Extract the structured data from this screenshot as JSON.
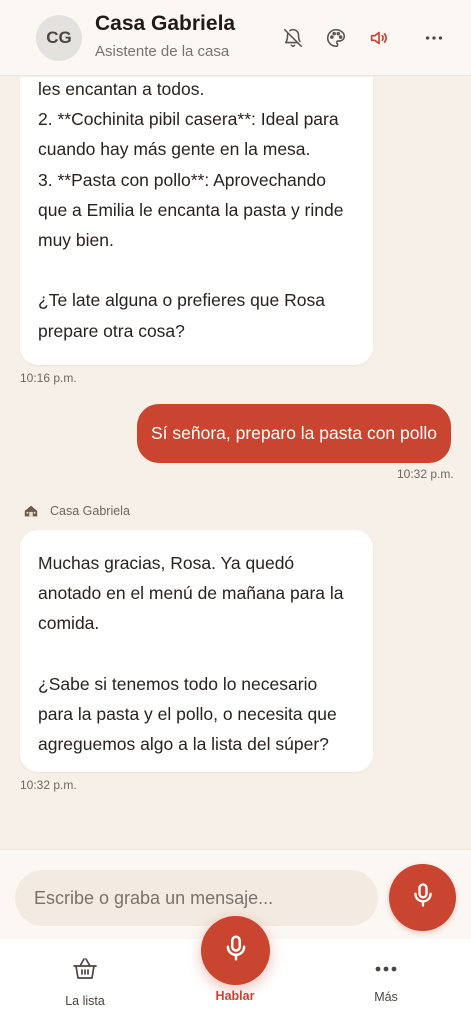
{
  "header": {
    "avatar_initials": "CG",
    "title": "Casa Gabriela",
    "subtitle": "Asistente de la casa",
    "icons": [
      "bell-off-icon",
      "palette-icon",
      "speaker-icon",
      "more-icon"
    ]
  },
  "messages": [
    {
      "from": "assistant",
      "text": "les encantan a todos.\n2. **Cochinita pibil casera**: Ideal para cuando hay más gente en la mesa.\n3. **Pasta con pollo**: Aprovechando que a Emilia le encanta la pasta y rinde muy bien.\n\n¿Te late alguna o prefieres que Rosa prepare otra cosa?",
      "time": "10:16 p.m."
    },
    {
      "from": "user",
      "text": "Sí señora, preparo la pasta con pollo",
      "time": "10:32 p.m."
    },
    {
      "from": "assistant",
      "sender": "Casa Gabriela",
      "text": "Muchas gracias, Rosa. Ya quedó anotado en el menú de mañana para la comida.\n\n¿Sabe si tenemos todo lo necesario para la pasta y el pollo, o necesita que agreguemos algo a la lista del súper?",
      "time": "10:32 p.m."
    }
  ],
  "composer": {
    "placeholder": "Escribe o graba un mensaje..."
  },
  "tabs": {
    "list_label": "La lista",
    "talk_label": "Hablar",
    "more_label": "Más"
  },
  "colors": {
    "accent": "#c9452f",
    "background": "#f6f0e8",
    "bubble": "#ffffff"
  }
}
